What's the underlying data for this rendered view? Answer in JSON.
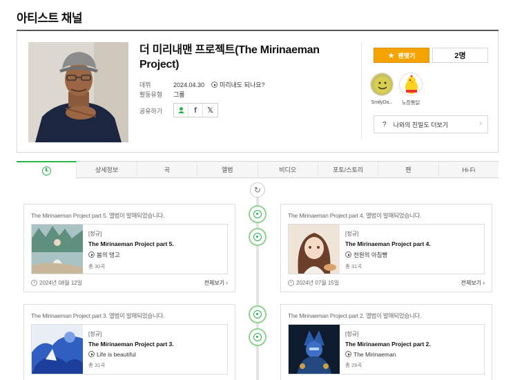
{
  "page": {
    "title": "아티스트 채널"
  },
  "artist": {
    "name": "더 미리내맨 프로젝트(The Mirinaeman Project)",
    "debut_label": "데뷔",
    "debut_date": "2024.04.30",
    "debut_song": "미리내도 되나요?",
    "type_label": "활동유형",
    "type_value": "그룹",
    "share_label": "공유하기",
    "share_icons": [
      "friends-icon",
      "facebook-icon",
      "x-icon"
    ]
  },
  "fan": {
    "button_label": "팬맺기",
    "count": "2명"
  },
  "badges": [
    {
      "name": "SmilyDa...",
      "icon": "smiley-icon"
    },
    {
      "name": "노랑통닭",
      "icon": "chicken-icon"
    }
  ],
  "more_friend": {
    "label": "나와의 친밀도 더보기"
  },
  "tabs": [
    {
      "label": "",
      "icon": "clock-icon"
    },
    {
      "label": "상세정보"
    },
    {
      "label": "곡"
    },
    {
      "label": "앨범"
    },
    {
      "label": "비디오"
    },
    {
      "label": "포토/스토리"
    },
    {
      "label": "팬"
    },
    {
      "label": "Hi-Fi"
    }
  ],
  "timeline": [
    {
      "headline": "The Mirinaeman Project part 5. 앨범이 발매되었습니다.",
      "type": "[정규]",
      "album": "The Mirinaeman Project part 5.",
      "song": "봄의 탱고",
      "count": "총 30곡",
      "date": "2024년 08월 12일",
      "more": "전체보기"
    },
    {
      "headline": "The Mirinaeman Project part 4. 앨범이 발매되었습니다.",
      "type": "[정규]",
      "album": "The Mirinaeman Project part 4.",
      "song": "천원의 아침빵",
      "count": "총 31곡",
      "date": "2024년 07월 15일",
      "more": "전체보기"
    },
    {
      "headline": "The Mirinaeman Project part 3. 앨범이 발매되었습니다.",
      "type": "[정규]",
      "album": "The Mirinaeman Project part 3.",
      "song": "Life is beautiful",
      "count": "총 31곡"
    },
    {
      "headline": "The Mirinaeman Project part 2. 앨범이 발매되었습니다.",
      "type": "[정규]",
      "album": "The Mirinaeman Project part 2.",
      "song": "The Mirinaeman",
      "count": "총 29곡"
    }
  ],
  "colors": {
    "accent_green": "#2bb44a",
    "fan_orange": "#f5a300"
  }
}
